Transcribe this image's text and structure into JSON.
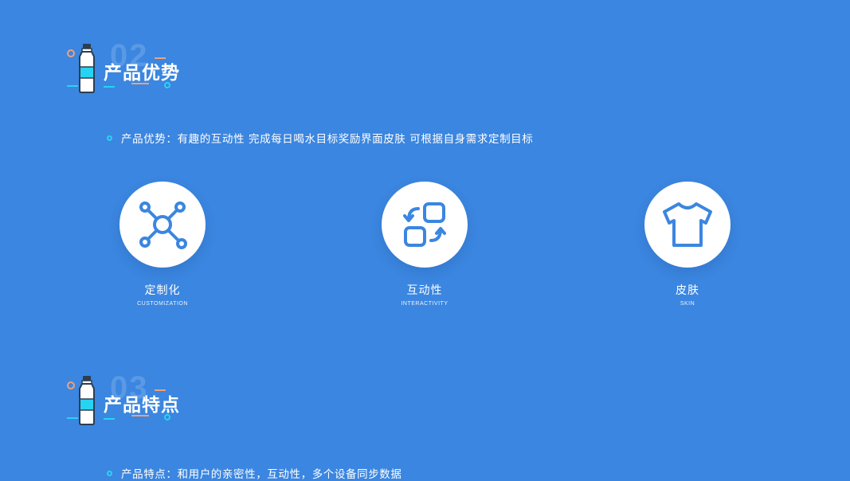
{
  "section1": {
    "number": "02",
    "title": "产品优势"
  },
  "advantage_line": "产品优势：有趣的互动性 完成每日喝水目标奖励界面皮肤 可根据自身需求定制目标",
  "features": [
    {
      "label": "定制化",
      "sub": "CUSTOMIZATION",
      "icon": "network-nodes-icon"
    },
    {
      "label": "互动性",
      "sub": "INTERACTIVITY",
      "icon": "swap-squares-icon"
    },
    {
      "label": "皮肤",
      "sub": "SKIN",
      "icon": "tshirt-icon"
    }
  ],
  "section2": {
    "number": "03",
    "title": "产品特点"
  },
  "feature_line": "产品特点：和用户的亲密性，互动性，多个设备同步数据",
  "colors": {
    "background": "#3b86e0",
    "accent_cyan": "#27d3f2",
    "accent_orange": "#f0a07a",
    "icon_blue": "#3b86e0"
  }
}
